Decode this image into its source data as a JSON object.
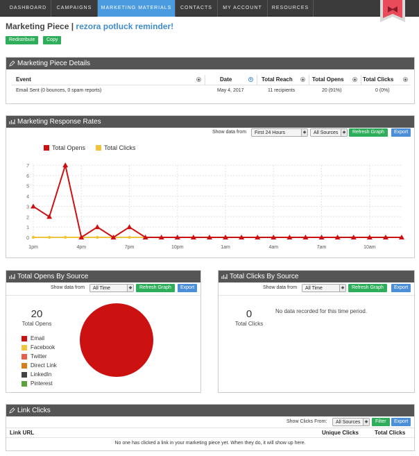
{
  "nav": {
    "items": [
      "DASHBOARD",
      "CAMPAIGNS",
      "MARKETING MATERIALS",
      "CONTACTS",
      "MY ACCOUNT",
      "RESOURCES"
    ],
    "active_index": 2
  },
  "page": {
    "title_prefix": "Marketing Piece",
    "separator": "|",
    "piece_name": "rezora potluck reminder!",
    "redistribute_label": "Redistribute",
    "copy_label": "Copy"
  },
  "details": {
    "heading": "Marketing Piece Details",
    "columns": [
      "Event",
      "Date",
      "Total Reach",
      "Total Opens",
      "Total Clicks"
    ],
    "row": [
      "Email Sent (0 bounces, 0 spam reports)",
      "May 4, 2017",
      "11 recipients",
      "20 (91%)",
      "0 (0%)"
    ]
  },
  "response": {
    "heading": "Marketing Response Rates",
    "show_label": "Show data from",
    "range_value": "First 24 Hours",
    "source_value": "All Sources",
    "refresh_label": "Refresh Graph",
    "export_label": "Export"
  },
  "chart_data": {
    "type": "line",
    "x": [
      "1pm",
      "2pm",
      "3pm",
      "4pm",
      "5pm",
      "6pm",
      "7pm",
      "8pm",
      "9pm",
      "10pm",
      "11pm",
      "12am",
      "1am",
      "2am",
      "3am",
      "4am",
      "5am",
      "6am",
      "7am",
      "8am",
      "9am",
      "10am",
      "11am",
      "12pm"
    ],
    "x_tick_labels": [
      "1pm",
      "4pm",
      "7pm",
      "10pm",
      "1am",
      "4am",
      "7am",
      "10am"
    ],
    "series": [
      {
        "name": "Total Opens",
        "color": "#cc1111",
        "values": [
          3,
          2,
          7,
          0,
          1,
          0,
          1,
          0,
          0,
          0,
          0,
          0,
          0,
          0,
          0,
          0,
          0,
          0,
          0,
          0,
          0,
          0,
          0,
          0
        ]
      },
      {
        "name": "Total Clicks",
        "color": "#f0c43a",
        "values": [
          0,
          0,
          0,
          0,
          0,
          0,
          0,
          0,
          0,
          0,
          0,
          0,
          0,
          0,
          0,
          0,
          0,
          0,
          0,
          0,
          0,
          0,
          0,
          0
        ]
      }
    ],
    "y_ticks": [
      0,
      1,
      2,
      3,
      4,
      5,
      6,
      7
    ],
    "ylim": [
      0,
      7
    ],
    "grid": true,
    "legend": "top-left"
  },
  "opens_by_source": {
    "heading": "Total Opens By Source",
    "show_label": "Show data from",
    "range_value": "All Time",
    "refresh_label": "Refresh Graph",
    "export_label": "Export",
    "total": "20",
    "total_label": "Total Opens",
    "sources": [
      {
        "name": "Email",
        "color": "#cc1111"
      },
      {
        "name": "Facebook",
        "color": "#f0c43a"
      },
      {
        "name": "Twitter",
        "color": "#e9604a"
      },
      {
        "name": "Direct Link",
        "color": "#d97c1a"
      },
      {
        "name": "LinkedIn",
        "color": "#444444"
      },
      {
        "name": "Pinterest",
        "color": "#58a33a"
      }
    ],
    "pie_values": [
      20,
      0,
      0,
      0,
      0,
      0
    ]
  },
  "clicks_by_source": {
    "heading": "Total Clicks By Source",
    "show_label": "Show data from",
    "range_value": "All Time",
    "refresh_label": "Refresh Graph",
    "export_label": "Export",
    "total": "0",
    "total_label": "Total Clicks",
    "empty_message": "No data recorded for this time period."
  },
  "link_clicks": {
    "heading": "Link Clicks",
    "show_label": "Show Clicks From:",
    "source_value": "All Sources",
    "filter_label": "Filter",
    "export_label": "Export",
    "columns": [
      "Link URL",
      "Unique Clicks",
      "Total Clicks"
    ],
    "empty_message": "No one has clicked a link in your marketing piece yet. When they do, it will show up here."
  },
  "colors": {
    "nav_bg": "#3b3b3b",
    "nav_active": "#4a9be0",
    "header_bg": "#555555",
    "green_button": "#2eae5a",
    "blue_button": "#4a8fd8",
    "title_link": "#3f8ccf"
  }
}
